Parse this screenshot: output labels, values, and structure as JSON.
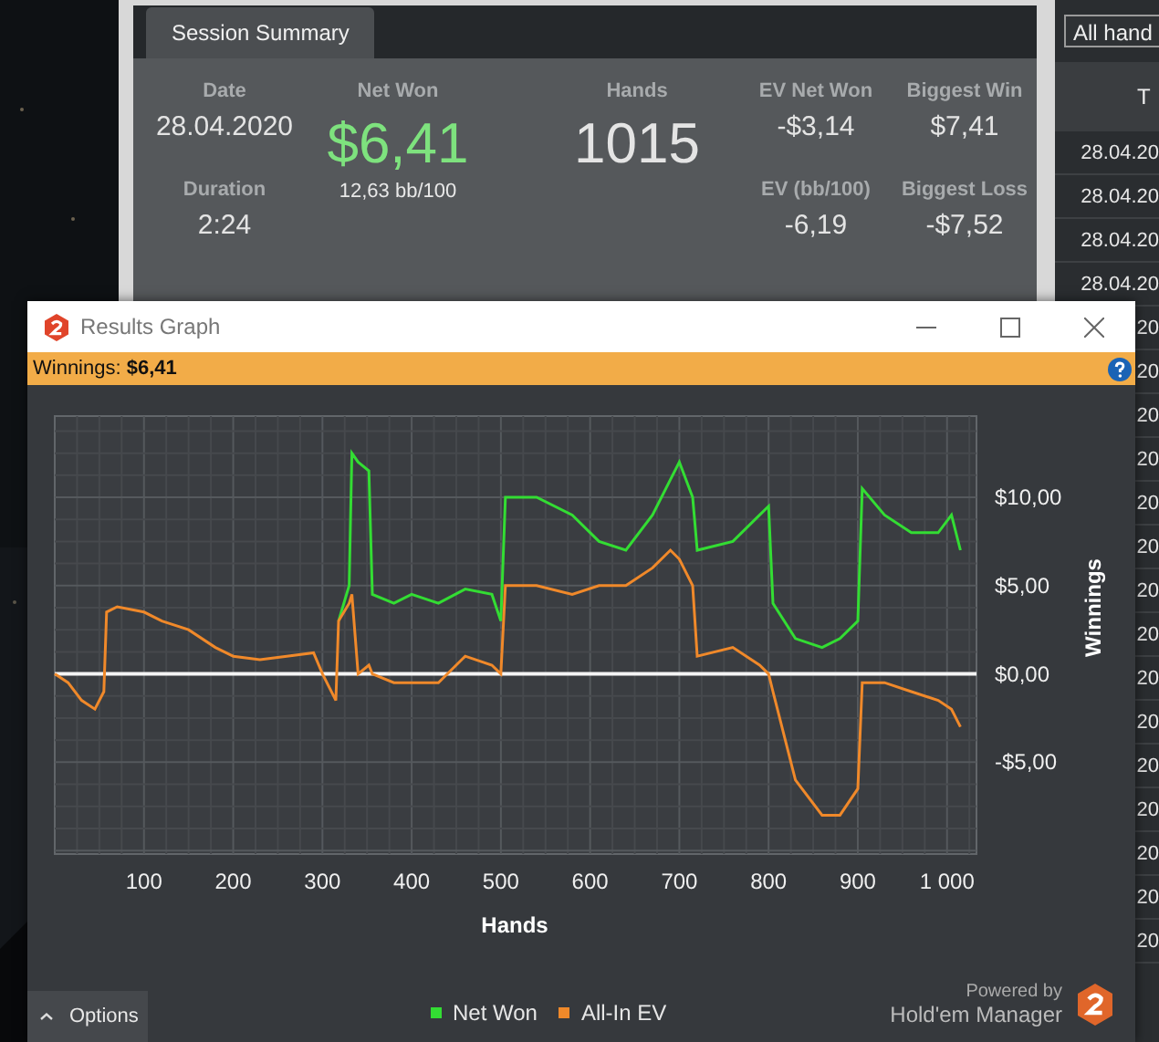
{
  "app": {
    "tabs": [
      {
        "label": "Session Summary",
        "selected": true
      }
    ],
    "summary": {
      "date": {
        "label": "Date",
        "value": "28.04.2020"
      },
      "duration": {
        "label": "Duration",
        "value": "2:24"
      },
      "net_won": {
        "label": "Net Won",
        "value": "$6,41",
        "sub": "12,63 bb/100"
      },
      "hands": {
        "label": "Hands",
        "value": "1015"
      },
      "stats": [
        {
          "label": "EV Net Won",
          "value": "-$3,14"
        },
        {
          "label": "Biggest Win",
          "value": "$7,41"
        },
        {
          "label": "EV (bb/100)",
          "value": "-6,19"
        },
        {
          "label": "Biggest Loss",
          "value": "-$7,52"
        }
      ]
    },
    "filter": {
      "value": "All hand"
    },
    "list": {
      "column_1": "T",
      "rows": [
        "28.04.20",
        "28.04.20",
        "28.04.20",
        "28.04.20",
        "20",
        "20",
        "20",
        "20",
        "20",
        "20",
        "20",
        "20",
        "20",
        "20",
        "20",
        "20",
        "20",
        "20",
        "20"
      ]
    }
  },
  "graph": {
    "title": "Results Graph",
    "banner": "Winnings: **$6,41**",
    "chart_data": {
      "type": "line",
      "xlabel": "Hands",
      "ylabel": "Winnings",
      "x": [
        0,
        15,
        30,
        45,
        55,
        58,
        70,
        100,
        120,
        150,
        180,
        200,
        230,
        260,
        290,
        300,
        315,
        318,
        330,
        333,
        340,
        352,
        356,
        380,
        400,
        430,
        460,
        490,
        500,
        505,
        540,
        580,
        610,
        640,
        670,
        690,
        700,
        715,
        720,
        760,
        790,
        800,
        805,
        830,
        860,
        880,
        900,
        905,
        930,
        960,
        990,
        1005,
        1015
      ],
      "series": [
        {
          "name": "Net Won",
          "color": "#33dd33",
          "values": [
            null,
            null,
            null,
            null,
            null,
            null,
            null,
            null,
            null,
            null,
            null,
            null,
            null,
            null,
            null,
            null,
            null,
            3,
            5,
            12.5,
            12,
            11.5,
            4.5,
            4,
            4.5,
            4,
            4.8,
            4.5,
            3,
            10,
            10,
            9,
            7.5,
            7,
            9,
            11,
            12,
            10,
            7,
            7.5,
            9,
            9.5,
            4,
            2,
            1.5,
            2,
            3,
            10.5,
            9,
            8,
            8,
            9,
            7
          ]
        },
        {
          "name": "All-In EV",
          "color": "#f0892a",
          "values": [
            0,
            -0.5,
            -1.5,
            -2,
            -1,
            3.5,
            3.8,
            3.5,
            3,
            2.5,
            1.5,
            1,
            0.8,
            1,
            1.2,
            0,
            -1.5,
            3,
            4,
            4.5,
            0,
            0.5,
            0,
            -0.5,
            -0.5,
            -0.5,
            1,
            0.5,
            0,
            5,
            5,
            4.5,
            5,
            5,
            6,
            7,
            6.5,
            5,
            1,
            1.5,
            0.5,
            0,
            -1,
            -6,
            -8,
            -8,
            -6.5,
            -0.5,
            -0.5,
            -1,
            -1.5,
            -2,
            -3
          ]
        }
      ],
      "grid": true,
      "xlim": [
        0,
        1033
      ],
      "ylim": [
        -10.2,
        14.6
      ],
      "xticks": [
        100,
        200,
        300,
        400,
        500,
        600,
        700,
        800,
        900,
        {
          "value": 1000,
          "label": "1 000"
        }
      ],
      "yticks": [
        {
          "value": 10,
          "label": "$10,00"
        },
        {
          "value": 5,
          "label": "$5,00"
        },
        {
          "value": 0,
          "label": "$0,00"
        },
        {
          "value": -5,
          "label": "-$5,00"
        }
      ]
    },
    "options_button": "Options",
    "powered_by": "Powered by",
    "brand": "Hold'em Manager"
  }
}
